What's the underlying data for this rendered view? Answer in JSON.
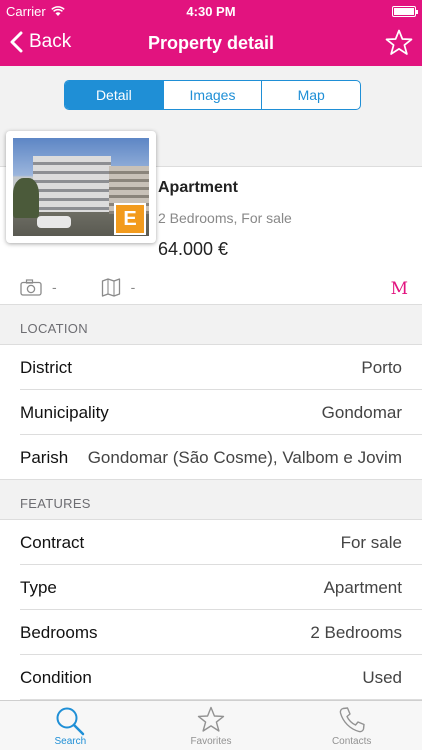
{
  "status_bar": {
    "carrier": "Carrier",
    "time": "4:30 PM",
    "wifi_icon": "wifi-icon",
    "battery_icon": "battery-icon"
  },
  "nav": {
    "back_label": "Back",
    "title": "Property detail",
    "favorite_icon": "star-icon"
  },
  "tabs": [
    {
      "label": "Detail",
      "active": true
    },
    {
      "label": "Images",
      "active": false
    },
    {
      "label": "Map",
      "active": false
    }
  ],
  "listing": {
    "type": "Apartment",
    "subtitle": "2 Bedrooms, For sale",
    "price": "64.000 €",
    "energy_rating": "E",
    "photo_count": "-",
    "plan_count": "-",
    "brand_mark": "M"
  },
  "location": {
    "header": "LOCATION",
    "rows": [
      {
        "label": "District",
        "value": "Porto"
      },
      {
        "label": "Municipality",
        "value": "Gondomar"
      },
      {
        "label": "Parish",
        "value": "Gondomar (São Cosme), Valbom e Jovim"
      }
    ]
  },
  "features": {
    "header": "FEATURES",
    "rows": [
      {
        "label": "Contract",
        "value": "For sale"
      },
      {
        "label": "Type",
        "value": "Apartment"
      },
      {
        "label": "Bedrooms",
        "value": "2 Bedrooms"
      },
      {
        "label": "Condition",
        "value": "Used"
      }
    ]
  },
  "tab_bar": [
    {
      "label": "Search",
      "icon": "search-icon",
      "active": true
    },
    {
      "label": "Favorites",
      "icon": "star-icon",
      "active": false
    },
    {
      "label": "Contacts",
      "icon": "phone-icon",
      "active": false
    }
  ],
  "colors": {
    "brand": "#e2137f",
    "accent": "#1f8fd6",
    "energy": "#f29b1d"
  }
}
